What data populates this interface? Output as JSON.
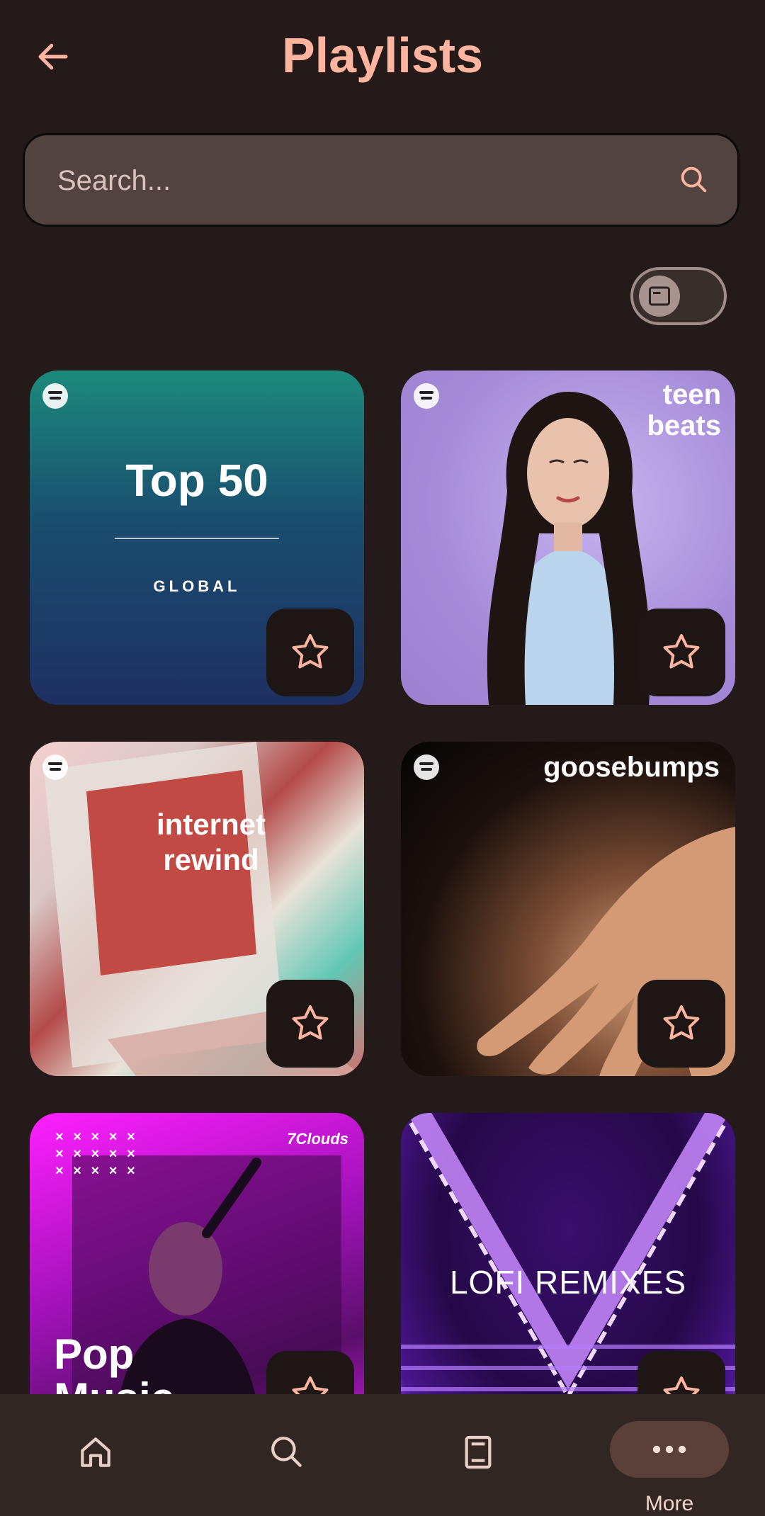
{
  "header": {
    "title": "Playlists"
  },
  "search": {
    "placeholder": "Search..."
  },
  "playlists": [
    {
      "title": "Top 50",
      "subtitle": "GLOBAL"
    },
    {
      "title_line1": "teen",
      "title_line2": "beats"
    },
    {
      "title_line1": "internet",
      "title_line2": "rewind"
    },
    {
      "title": "goosebumps"
    },
    {
      "title_line1": "Pop",
      "title_line2": "Music",
      "brand": "7Clouds"
    },
    {
      "title": "LOFI REMIXES"
    }
  ],
  "bottom_nav": {
    "items": [
      {
        "icon": "home-icon"
      },
      {
        "icon": "search-icon"
      },
      {
        "icon": "library-icon"
      },
      {
        "icon": "more-icon",
        "label": "More"
      }
    ]
  },
  "colors": {
    "background": "#241a19",
    "accent": "#ffb4a0",
    "search_bg": "#524341",
    "nav_bg": "#322623",
    "nav_active_pill": "#5a4039"
  }
}
